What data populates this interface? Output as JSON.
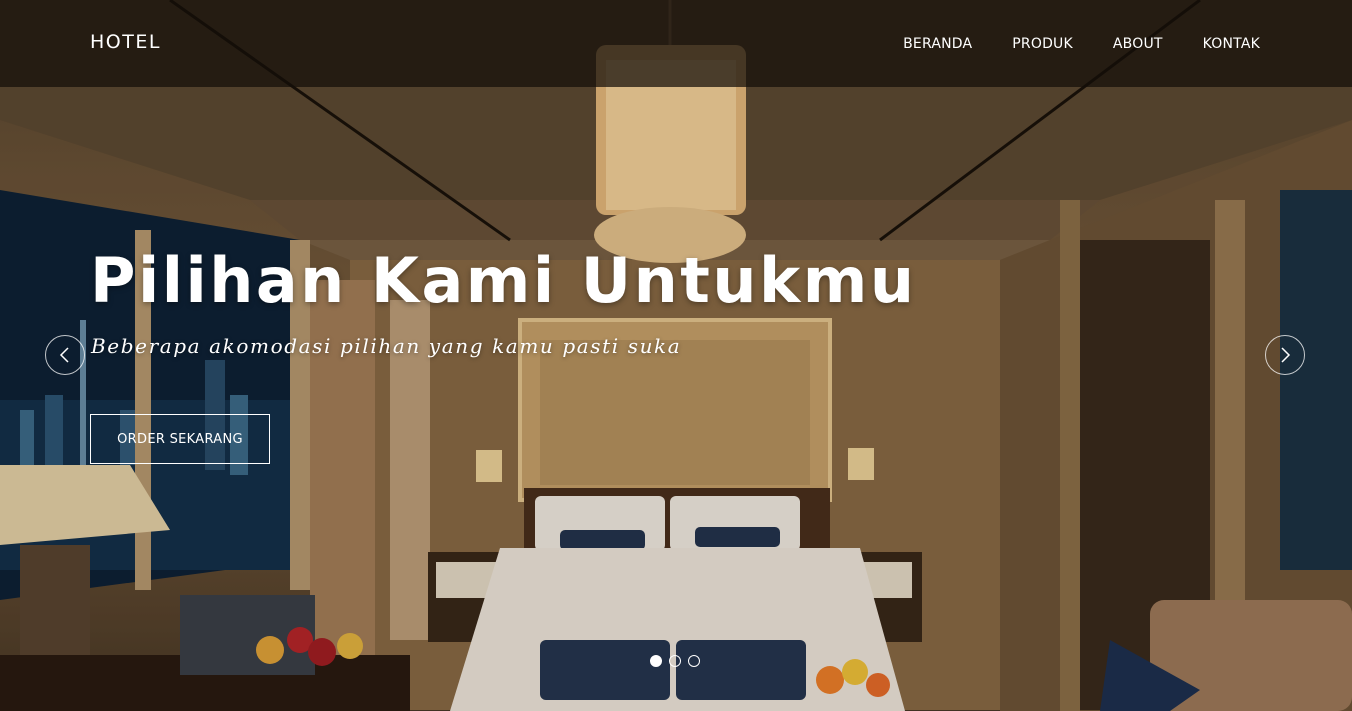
{
  "navbar": {
    "brand": "HOTEL",
    "links": [
      {
        "label": "BERANDA"
      },
      {
        "label": "PRODUK"
      },
      {
        "label": "ABOUT"
      },
      {
        "label": "KONTAK"
      }
    ]
  },
  "carousel": {
    "title": "Pilihan Kami Untukmu",
    "subtitle": "Beberapa akomodasi pilihan yang kamu pasti suka",
    "button_label": "ORDER SEKARANG",
    "prev_icon": "chevron-left-icon",
    "next_icon": "chevron-right-icon",
    "slide_count": 3,
    "active_slide": 1
  },
  "colors": {
    "text": "#ffffff",
    "navbar_bg": "rgba(20,14,8,0.72)",
    "room_tone": "#7a5e3c"
  }
}
